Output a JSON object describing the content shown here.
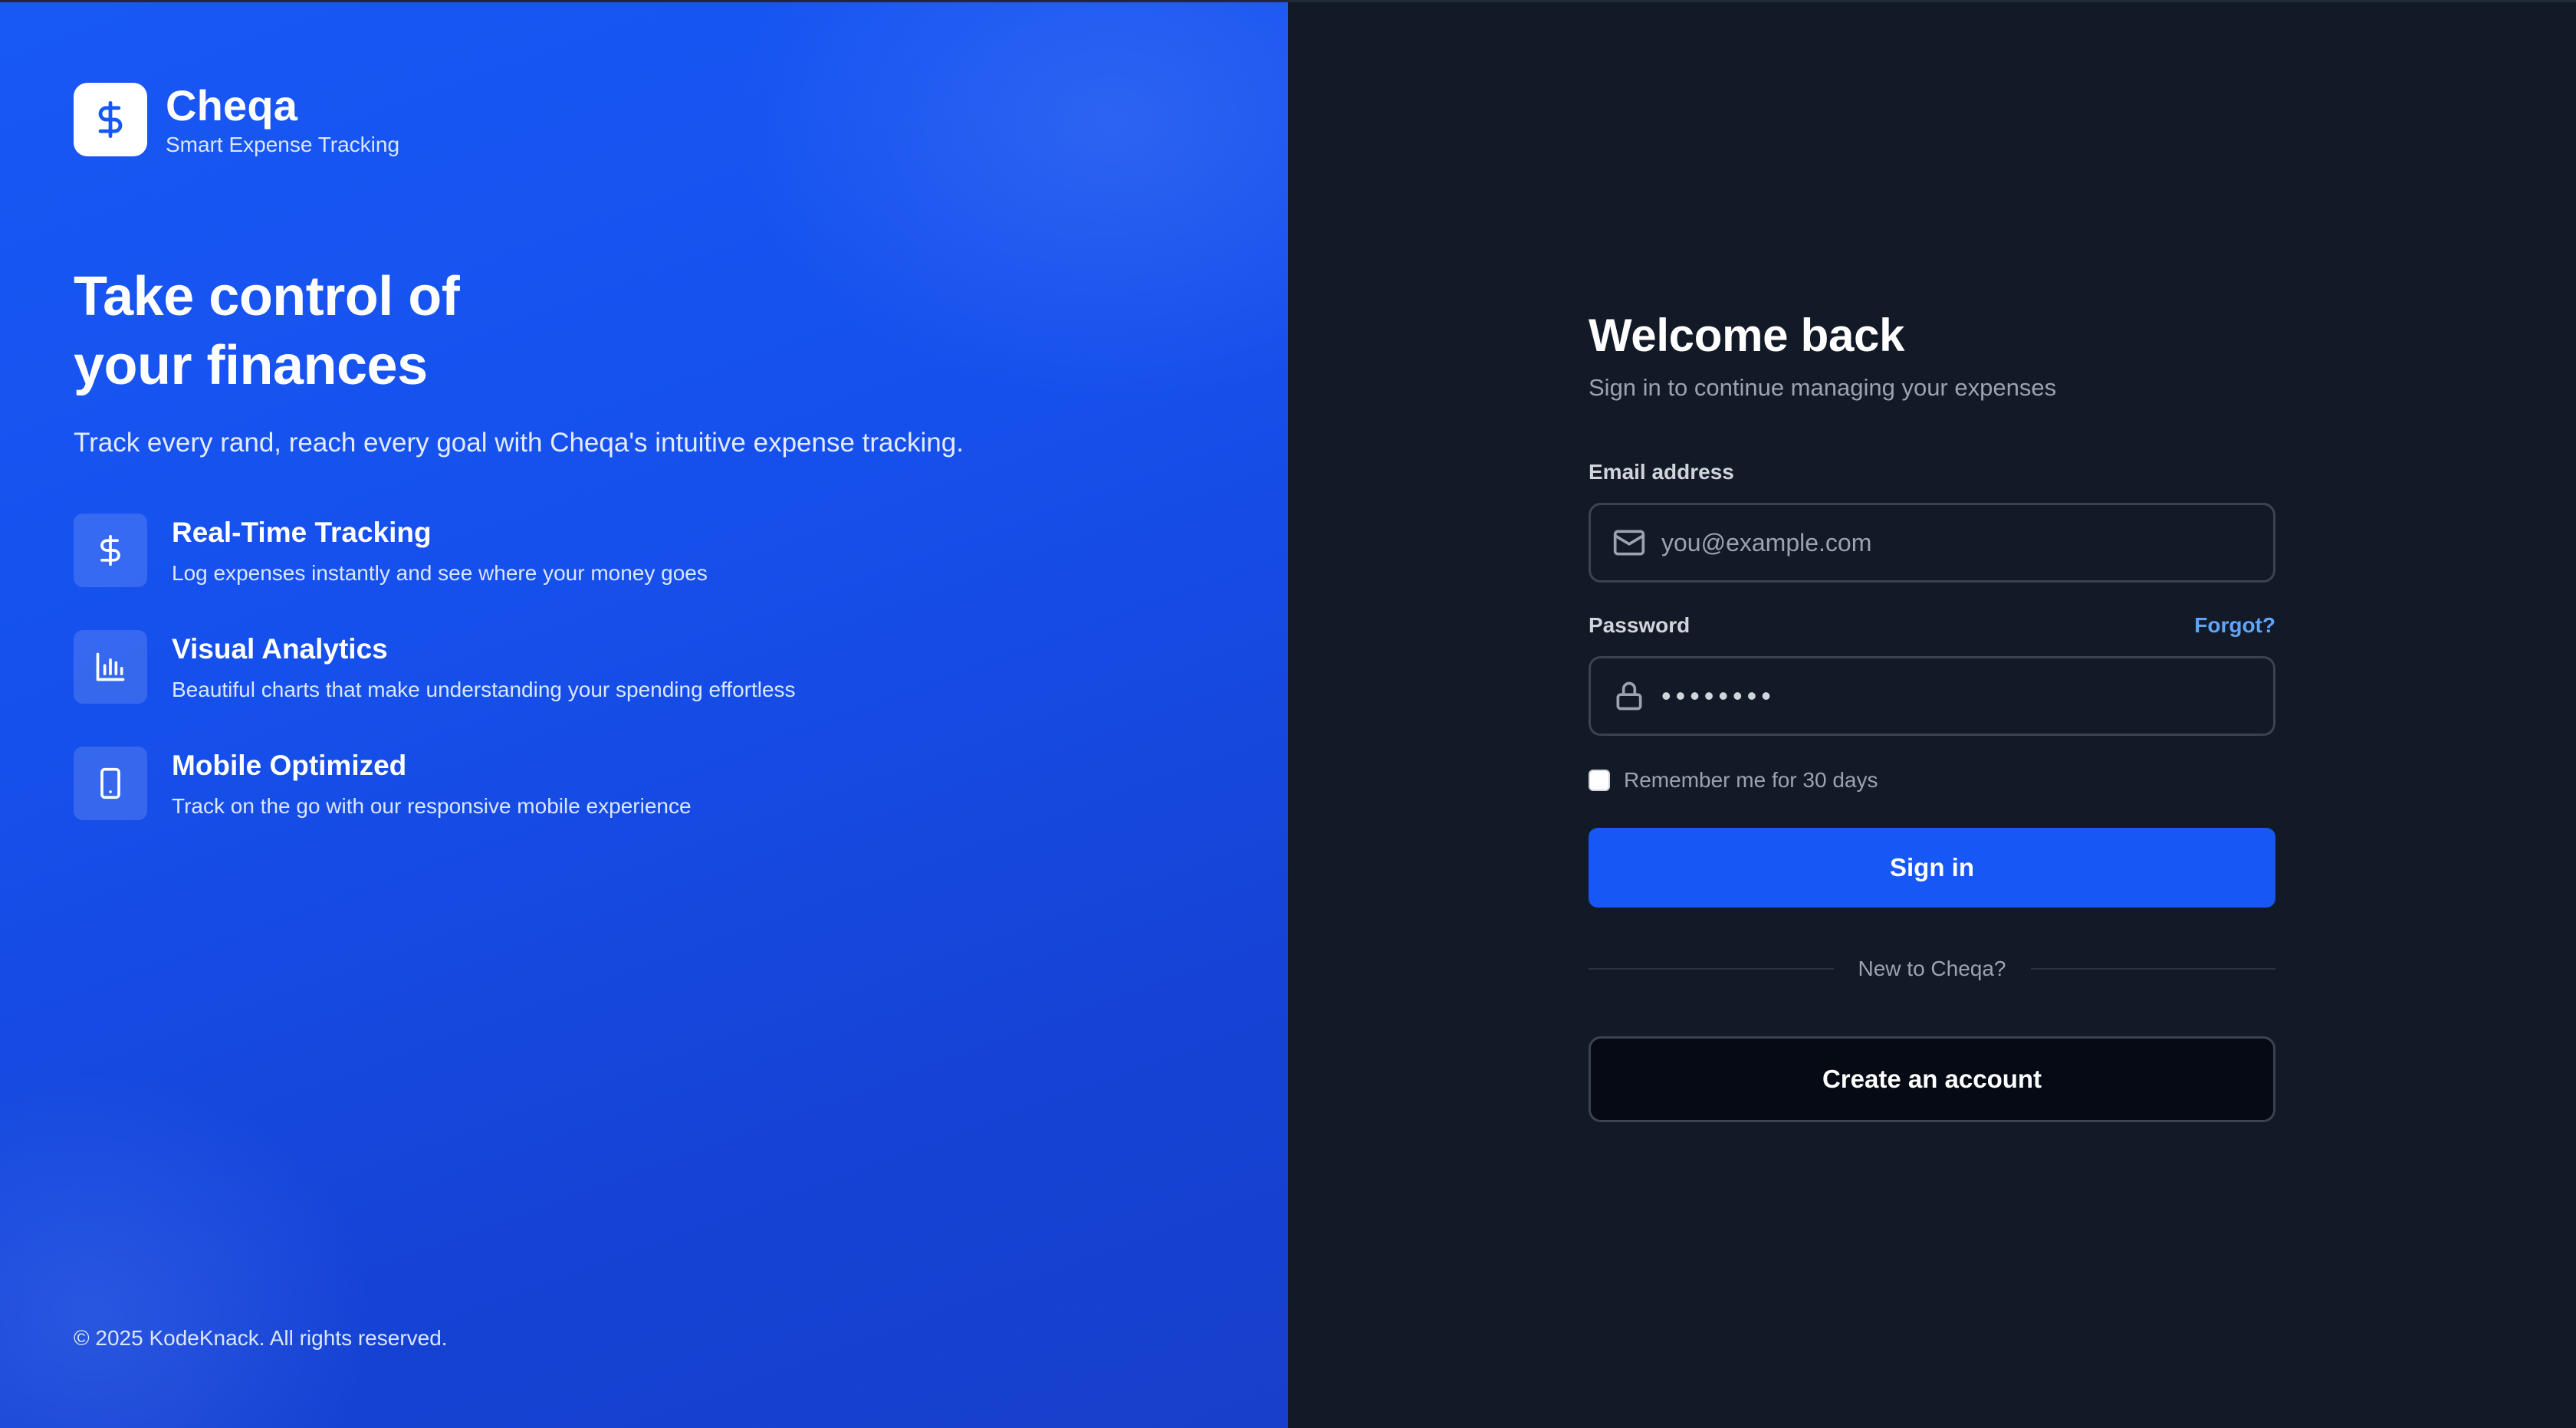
{
  "brand": {
    "name": "Cheqa",
    "tagline": "Smart Expense Tracking",
    "logo_icon": "dollar-icon",
    "logo_bg": "#ffffff",
    "accent": "#1657f5"
  },
  "hero": {
    "title_line1": "Take control of",
    "title_line2": "your finances",
    "subtitle": "Track every rand, reach every goal with Cheqa's intuitive expense tracking."
  },
  "features": [
    {
      "icon": "dollar-icon",
      "title": "Real-Time Tracking",
      "description": "Log expenses instantly and see where your money goes"
    },
    {
      "icon": "bar-chart-icon",
      "title": "Visual Analytics",
      "description": "Beautiful charts that make understanding your spending effortless"
    },
    {
      "icon": "smartphone-icon",
      "title": "Mobile Optimized",
      "description": "Track on the go with our responsive mobile experience"
    }
  ],
  "footer": {
    "copyright": "© 2025 KodeKnack. All rights reserved."
  },
  "login": {
    "title": "Welcome back",
    "subtitle": "Sign in to continue managing your expenses",
    "email": {
      "label": "Email address",
      "placeholder": "you@example.com",
      "value": "",
      "icon": "mail-icon"
    },
    "password": {
      "label": "Password",
      "forgot_label": "Forgot?",
      "value": "••••••••",
      "icon": "lock-icon"
    },
    "remember_label": "Remember me for 30 days",
    "remember_checked": false,
    "signin_label": "Sign in",
    "divider_text": "New to Cheqa?",
    "create_label": "Create an account"
  }
}
